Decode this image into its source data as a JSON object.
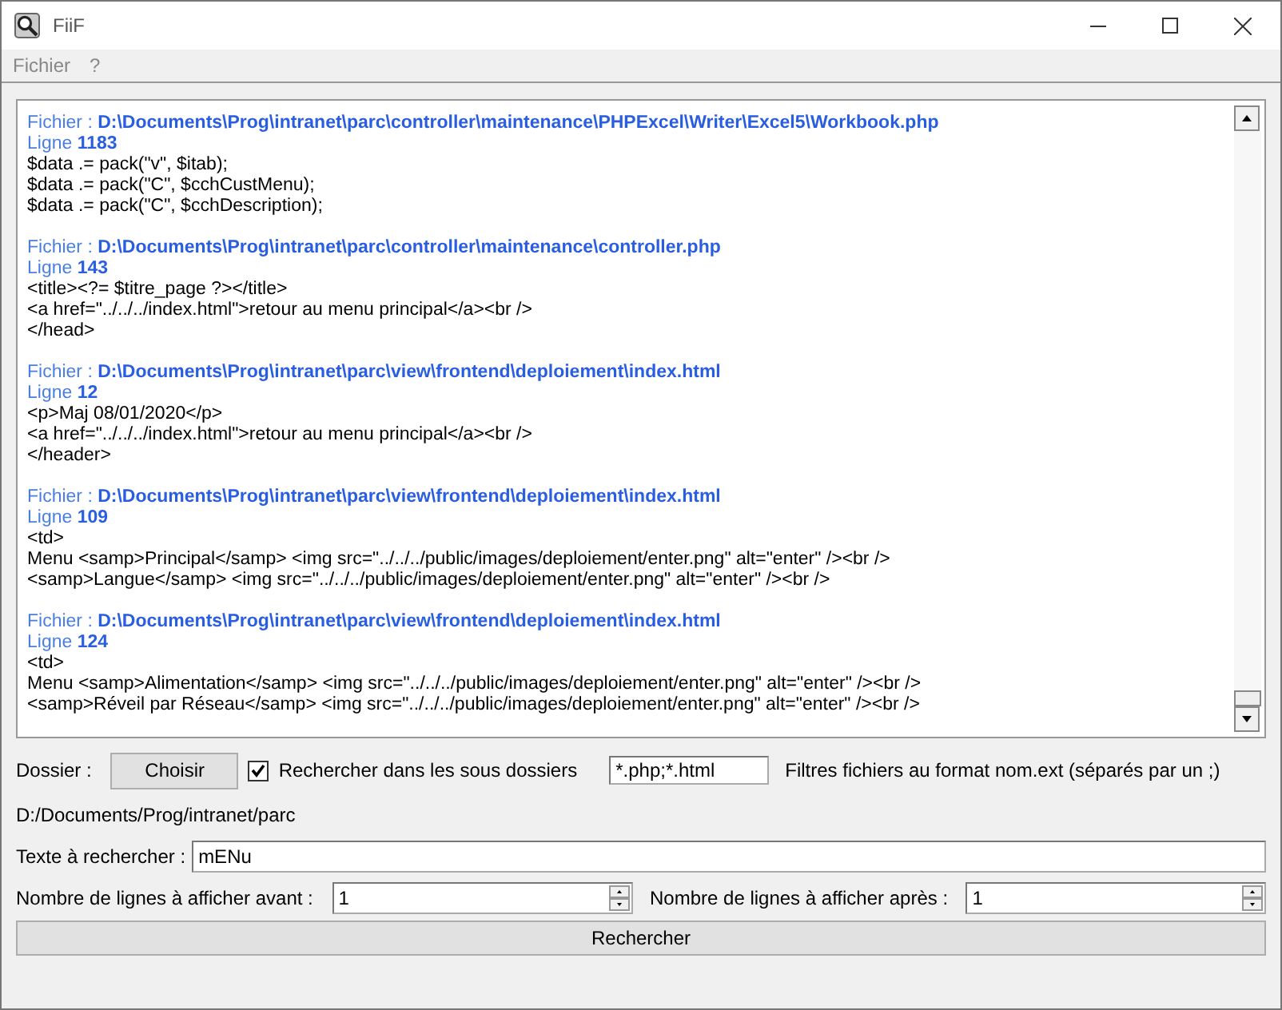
{
  "window": {
    "title": "FiiF"
  },
  "menu": [
    "Fichier",
    "?"
  ],
  "results": [
    {
      "file": "Fichier : **D:\\Documents\\Prog\\intranet\\parc\\controller\\maintenance\\PHPExcel\\Writer\\Excel5\\Workbook.php**",
      "line": "Ligne **1183**",
      "code": [
        "$data .= pack(\"v\", $itab);",
        "$data .= pack(\"C\", $cchCustMenu);",
        "$data .= pack(\"C\", $cchDescription);"
      ]
    },
    {
      "file": "Fichier : **D:\\Documents\\Prog\\intranet\\parc\\controller\\maintenance\\controller.php**",
      "line": "Ligne **143**",
      "code": [
        "<title><?= $titre_page ?></title>",
        "<a href=\"../../../index.html\">retour au menu principal</a><br />",
        "</head>"
      ]
    },
    {
      "file": "Fichier : **D:\\Documents\\Prog\\intranet\\parc\\view\\frontend\\deploiement\\index.html**",
      "line": "Ligne **12**",
      "code": [
        "<p>Maj 08/01/2020</p>",
        "<a href=\"../../../index.html\">retour au menu principal</a><br />",
        "</header>"
      ]
    },
    {
      "file": "Fichier : **D:\\Documents\\Prog\\intranet\\parc\\view\\frontend\\deploiement\\index.html**",
      "line": "Ligne **109**",
      "code": [
        "<td>",
        "Menu <samp>Principal</samp> <img src=\"../../../public/images/deploiement/enter.png\" alt=\"enter\" /><br />",
        "<samp>Langue</samp> <img src=\"../../../public/images/deploiement/enter.png\" alt=\"enter\" /><br />"
      ]
    },
    {
      "file": "Fichier : **D:\\Documents\\Prog\\intranet\\parc\\view\\frontend\\deploiement\\index.html**",
      "line": "Ligne **124**",
      "code": [
        "<td>",
        "Menu <samp>Alimentation</samp> <img src=\"../../../public/images/deploiement/enter.png\" alt=\"enter\" /><br />",
        "<samp>Réveil par Réseau</samp> <img src=\"../../../public/images/deploiement/enter.png\" alt=\"enter\" /><br />"
      ]
    }
  ],
  "folder": {
    "label": "Dossier :",
    "button": "Choisir",
    "subfolders": {
      "label": "Rechercher dans les sous dossiers",
      "checked": true
    },
    "filter": "*.php;*.html",
    "filter_hint": "Filtres fichiers au format nom.ext (séparés par un ;)",
    "path": "D:/Documents/Prog/intranet/parc"
  },
  "search": {
    "label": "Texte à rechercher :",
    "value": "mENu"
  },
  "before": {
    "label": "Nombre de lignes à afficher avant :",
    "value": "1"
  },
  "after": {
    "label": "Nombre de lignes à afficher après :",
    "value": "1"
  },
  "submit": "Rechercher"
}
